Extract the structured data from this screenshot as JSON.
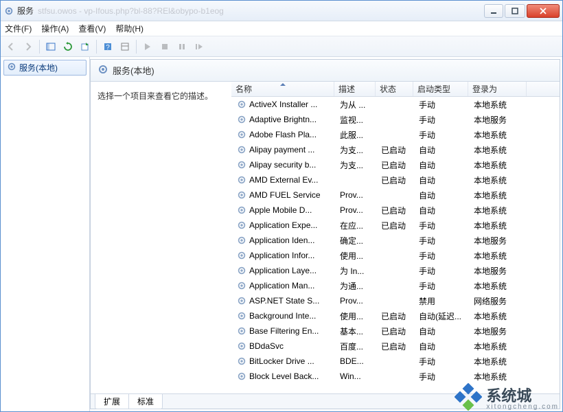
{
  "window": {
    "title": "服务",
    "faded": "stfsu.owos - vp-Ifous.php?bl-88?REl&obypo-b1eog"
  },
  "menubar": [
    "文件(F)",
    "操作(A)",
    "查看(V)",
    "帮助(H)"
  ],
  "nav": {
    "root": "服务(本地)"
  },
  "pane": {
    "header": "服务(本地)",
    "desc": "选择一个项目来查看它的描述。"
  },
  "columns": {
    "name": "名称",
    "desc": "描述",
    "status": "状态",
    "startup": "启动类型",
    "logon": "登录为"
  },
  "tabs": {
    "extended": "扩展",
    "standard": "标准"
  },
  "watermark": {
    "big": "系统城",
    "sub": "xitongcheng.com"
  },
  "services": [
    {
      "name": "ActiveX Installer ...",
      "desc": "为从 ...",
      "status": "",
      "startup": "手动",
      "logon": "本地系统"
    },
    {
      "name": "Adaptive Brightn...",
      "desc": "监视...",
      "status": "",
      "startup": "手动",
      "logon": "本地服务"
    },
    {
      "name": "Adobe Flash Pla...",
      "desc": "此服...",
      "status": "",
      "startup": "手动",
      "logon": "本地系统"
    },
    {
      "name": "Alipay payment ...",
      "desc": "为支...",
      "status": "已启动",
      "startup": "自动",
      "logon": "本地系统"
    },
    {
      "name": "Alipay security b...",
      "desc": "为支...",
      "status": "已启动",
      "startup": "自动",
      "logon": "本地系统"
    },
    {
      "name": "AMD External Ev...",
      "desc": "",
      "status": "已启动",
      "startup": "自动",
      "logon": "本地系统"
    },
    {
      "name": "AMD FUEL Service",
      "desc": "Prov...",
      "status": "",
      "startup": "自动",
      "logon": "本地系统"
    },
    {
      "name": "Apple Mobile D...",
      "desc": "Prov...",
      "status": "已启动",
      "startup": "自动",
      "logon": "本地系统"
    },
    {
      "name": "Application Expe...",
      "desc": "在应...",
      "status": "已启动",
      "startup": "手动",
      "logon": "本地系统"
    },
    {
      "name": "Application Iden...",
      "desc": "确定...",
      "status": "",
      "startup": "手动",
      "logon": "本地服务"
    },
    {
      "name": "Application Infor...",
      "desc": "使用...",
      "status": "",
      "startup": "手动",
      "logon": "本地系统"
    },
    {
      "name": "Application Laye...",
      "desc": "为 In...",
      "status": "",
      "startup": "手动",
      "logon": "本地服务"
    },
    {
      "name": "Application Man...",
      "desc": "为通...",
      "status": "",
      "startup": "手动",
      "logon": "本地系统"
    },
    {
      "name": "ASP.NET State S...",
      "desc": "Prov...",
      "status": "",
      "startup": "禁用",
      "logon": "网络服务"
    },
    {
      "name": "Background Inte...",
      "desc": "使用...",
      "status": "已启动",
      "startup": "自动(延迟...",
      "logon": "本地系统"
    },
    {
      "name": "Base Filtering En...",
      "desc": "基本...",
      "status": "已启动",
      "startup": "自动",
      "logon": "本地服务"
    },
    {
      "name": "BDdaSvc",
      "desc": "百度...",
      "status": "已启动",
      "startup": "自动",
      "logon": "本地系统"
    },
    {
      "name": "BitLocker Drive ...",
      "desc": "BDE...",
      "status": "",
      "startup": "手动",
      "logon": "本地系统"
    },
    {
      "name": "Block Level Back...",
      "desc": "Win...",
      "status": "",
      "startup": "手动",
      "logon": "本地系统"
    }
  ]
}
